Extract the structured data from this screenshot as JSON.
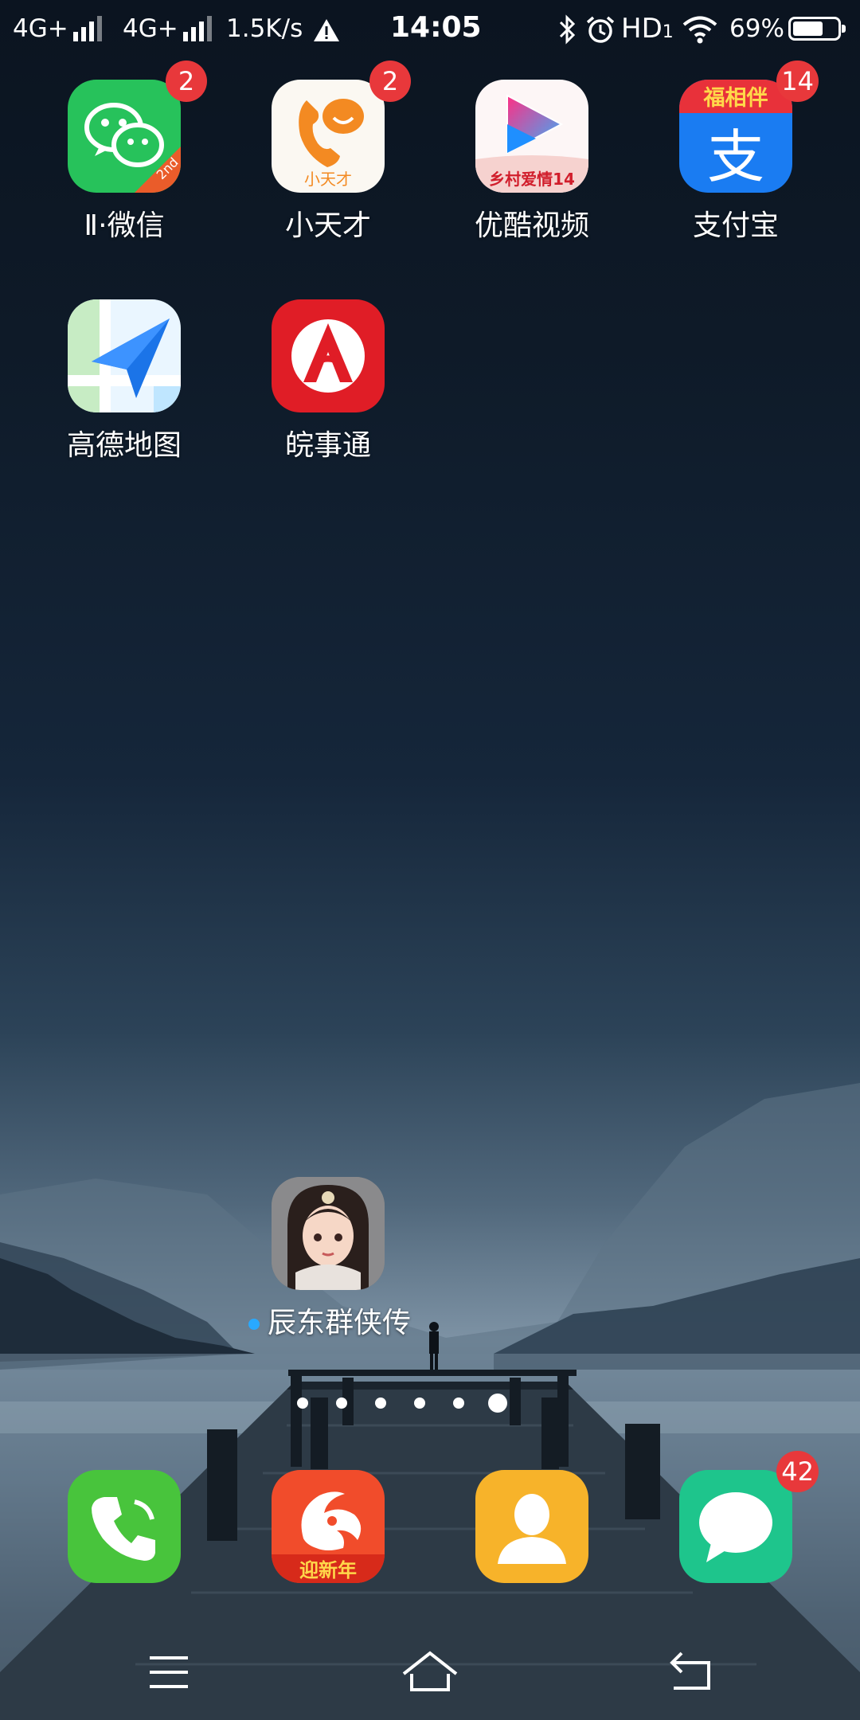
{
  "status_bar": {
    "sim1": "4G+",
    "sim2": "4G+",
    "net_speed": "1.5K/s",
    "time": "14:05",
    "hd": "HD",
    "hd_sub": "1",
    "battery": "69%",
    "battery_level": 0.69
  },
  "home": {
    "apps": [
      {
        "label": "Ⅱ·微信",
        "badge": "2",
        "icon": "wechat-clone-icon"
      },
      {
        "label": "小天才",
        "badge": "2",
        "icon": "xiaotiancai-icon"
      },
      {
        "label": "优酷视频",
        "badge": "",
        "icon": "youku-icon"
      },
      {
        "label": "支付宝",
        "badge": "14",
        "icon": "alipay-icon"
      },
      {
        "label": "高德地图",
        "badge": "",
        "icon": "amap-icon"
      },
      {
        "label": "皖事通",
        "badge": "",
        "icon": "wanshitong-icon"
      }
    ],
    "game_app": {
      "label": "辰东群侠传",
      "icon": "game-icon"
    }
  },
  "icon_text": {
    "wechat_tag": "2nd",
    "xiaotiancai_brand": "小天才",
    "youku_banner": "乡村爱情14",
    "alipay_banner": "福相伴",
    "alipay_glyph": "支",
    "uc_banner": "迎新年"
  },
  "page_indicator": {
    "count": 6,
    "active": 5
  },
  "dock": {
    "apps": [
      {
        "icon": "phone-icon",
        "badge": ""
      },
      {
        "icon": "uc-browser-icon",
        "badge": ""
      },
      {
        "icon": "contacts-icon",
        "badge": ""
      },
      {
        "icon": "messages-icon",
        "badge": "42"
      }
    ]
  },
  "nav": {
    "buttons": [
      "menu-icon",
      "home-icon",
      "back-icon"
    ]
  }
}
